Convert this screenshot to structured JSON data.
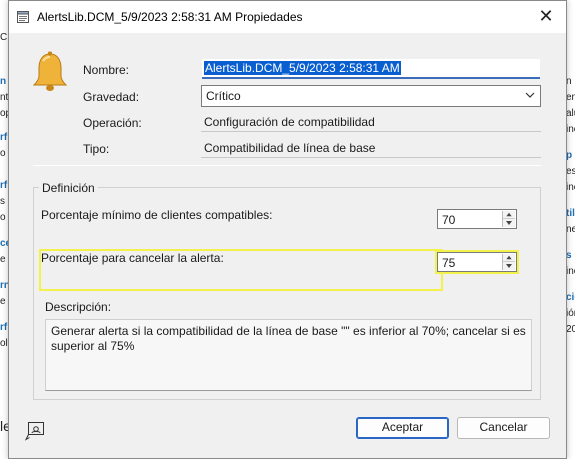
{
  "background": {
    "left_fragments": [
      "C",
      "n",
      "nt",
      "op",
      "rf",
      "o",
      "rf",
      "s",
      "o",
      "ce",
      "e",
      "rn",
      "e",
      "rf",
      "ol",
      "le"
    ],
    "right_fragments": [
      "n",
      "en",
      "alu",
      "ine",
      "p",
      "es",
      "ine",
      "til",
      "ne",
      "s",
      "ine",
      "cio",
      "ión",
      "20"
    ]
  },
  "dialog": {
    "title": "AlertsLib.DCM_5/9/2023 2:58:31 AM Propiedades",
    "close_glyph": "✕"
  },
  "form": {
    "name_label": "Nombre:",
    "name_value": "AlertsLib.DCM_5/9/2023 2:58:31 AM",
    "severity_label": "Gravedad:",
    "severity_value": "Crítico",
    "operation_label": "Operación:",
    "operation_value": "Configuración de compatibilidad",
    "type_label": "Tipo:",
    "type_value": "Compatibilidad de línea de base"
  },
  "definition": {
    "group_label": "Definición",
    "min_label": "Porcentaje mínimo de clientes compatibles:",
    "min_value": "70",
    "cancel_label": "Porcentaje para cancelar la alerta:",
    "cancel_value": "75",
    "description_label": "Descripción:",
    "description_text": "Generar alerta si la compatibilidad de la línea de base \"\" es inferior al 70%; cancelar si es superior al 75%"
  },
  "buttons": {
    "ok_label": "Aceptar",
    "cancel_label": "Cancelar"
  },
  "colors": {
    "accent": "#0a5fd0",
    "highlight": "#f2f24a",
    "bell": "#e8a52a"
  },
  "icons": [
    "properties-window-icon",
    "bell-alert-icon",
    "chevron-down-icon",
    "close-icon",
    "help-icon"
  ]
}
